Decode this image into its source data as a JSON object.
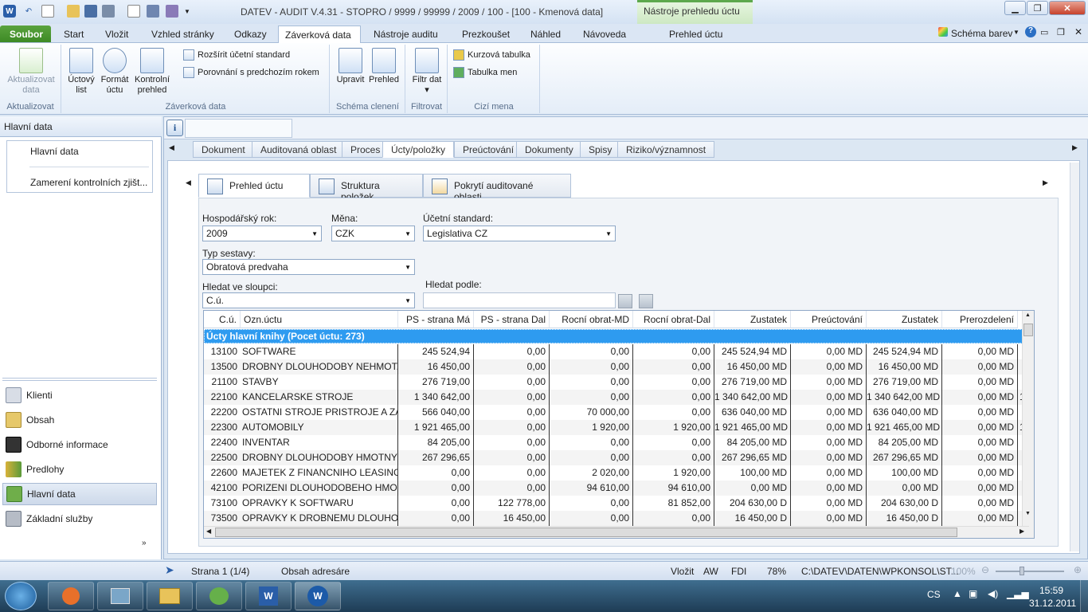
{
  "window": {
    "title": "DATEV - AUDIT V.4.31 - STOPRO / 9999 / 99999 / 2009 / 100  - [100 - Kmenová data]",
    "context_title": "Nástroje prehledu úctu"
  },
  "ribbon_tabs": [
    "Soubor",
    "Start",
    "Vložit",
    "Vzhled stránky",
    "Odkazy",
    "Záverková data",
    "Nástroje auditu",
    "Prezkoušet",
    "Náhled",
    "Návoveda",
    "Prehled úctu"
  ],
  "ribbon_right": {
    "scheme": "Schéma barev"
  },
  "ribbon": {
    "g1": {
      "btn": "Aktualizovat data",
      "label": "Aktualizovat"
    },
    "g2": {
      "b1": "Úctový list",
      "b2": "Formát úctu",
      "b3": "Kontrolní prehled",
      "s1": "Rozšírit účetní standard",
      "s2": "Porovnání s predchozím rokem",
      "label": "Záverková data"
    },
    "g3": {
      "b1": "Upravit",
      "b2": "Prehled",
      "label": "Schéma clenení"
    },
    "g4": {
      "b1": "Filtr dat",
      "label": "Filtrovat"
    },
    "g5": {
      "s1": "Kurzová tabulka",
      "s2": "Tabulka men",
      "label": "Cizí mena"
    }
  },
  "left": {
    "header": "Hlavní data",
    "items": [
      "Hlavní data",
      "Zamerení kontrolních zjišt..."
    ],
    "nav": [
      "Klienti",
      "Obsah",
      "Odborné informace",
      "Predlohy",
      "Hlavní data",
      "Základní služby"
    ]
  },
  "tabs2": [
    "Dokument",
    "Auditovaná oblast",
    "Proces",
    "Úcty/položky",
    "Preúctování",
    "Dokumenty",
    "Spisy",
    "Riziko/významnost"
  ],
  "tabs3": [
    "Prehled úctu",
    "Struktura položek",
    "Pokrytí auditované oblasti"
  ],
  "form": {
    "year_label": "Hospodářský rok:",
    "year": "2009",
    "cur_label": "Měna:",
    "cur": "CZK",
    "std_label": "Účetní standard:",
    "std": "Legislativa CZ",
    "type_label": "Typ sestavy:",
    "type": "Obratová predvaha",
    "search_col_label": "Hledat ve sloupci:",
    "search_col": "C.ú.",
    "search_by_label": "Hledat podle:",
    "search_by": ""
  },
  "grid": {
    "headers": [
      "C.ú.",
      "Ozn.úctu",
      "PS - strana Má ...",
      "PS - strana Dal",
      "Rocní obrat-MD",
      "Rocní obrat-Dal",
      "Zustatek",
      "Preúctování",
      "Zustatek",
      "Prerozdelení"
    ],
    "group": "Úcty hlavní knihy (Pocet úctu: 273)",
    "rows": [
      [
        "13100",
        "SOFTWARE",
        "245 524,94",
        "0,00",
        "0,00",
        "0,00",
        "245 524,94  MD",
        "0,00  MD",
        "245 524,94  MD",
        "0,00  MD",
        ""
      ],
      [
        "13500",
        "DROBNY DLOUHODOBY NEHMOT...",
        "16 450,00",
        "0,00",
        "0,00",
        "0,00",
        "16 450,00  MD",
        "0,00  MD",
        "16 450,00  MD",
        "0,00  MD",
        ""
      ],
      [
        "21100",
        "STAVBY",
        "276 719,00",
        "0,00",
        "0,00",
        "0,00",
        "276 719,00  MD",
        "0,00  MD",
        "276 719,00  MD",
        "0,00  MD",
        ""
      ],
      [
        "22100",
        "KANCELARSKE STROJE",
        "1 340 642,00",
        "0,00",
        "0,00",
        "0,00",
        "1 340 642,00  MD",
        "0,00  MD",
        "1 340 642,00  MD",
        "0,00  MD",
        "1"
      ],
      [
        "22200",
        "OSTATNI STROJE PRISTROJE A ZA...",
        "566 040,00",
        "0,00",
        "70 000,00",
        "0,00",
        "636 040,00  MD",
        "0,00  MD",
        "636 040,00  MD",
        "0,00  MD",
        ""
      ],
      [
        "22300",
        "AUTOMOBILY",
        "1 921 465,00",
        "0,00",
        "1 920,00",
        "1 920,00",
        "1 921 465,00  MD",
        "0,00  MD",
        "1 921 465,00  MD",
        "0,00  MD",
        "1"
      ],
      [
        "22400",
        "INVENTAR",
        "84 205,00",
        "0,00",
        "0,00",
        "0,00",
        "84 205,00  MD",
        "0,00  MD",
        "84 205,00  MD",
        "0,00  MD",
        ""
      ],
      [
        "22500",
        "DROBNY DLOUHODOBY HMOTNY ...",
        "267 296,65",
        "0,00",
        "0,00",
        "0,00",
        "267 296,65  MD",
        "0,00  MD",
        "267 296,65  MD",
        "0,00  MD",
        ""
      ],
      [
        "22600",
        "MAJETEK Z FINANCNIHO LEASINGU",
        "0,00",
        "0,00",
        "2 020,00",
        "1 920,00",
        "100,00  MD",
        "0,00  MD",
        "100,00  MD",
        "0,00  MD",
        ""
      ],
      [
        "42100",
        "PORIZENI DLOUHODOBEHO HMOT...",
        "0,00",
        "0,00",
        "94 610,00",
        "94 610,00",
        "0,00  MD",
        "0,00  MD",
        "0,00  MD",
        "0,00  MD",
        ""
      ],
      [
        "73100",
        "OPRAVKY K SOFTWARU",
        "0,00",
        "122 778,00",
        "0,00",
        "81 852,00",
        "204 630,00 D",
        "0,00  MD",
        "204 630,00 D",
        "0,00  MD",
        ""
      ],
      [
        "73500",
        "OPRAVKY K DROBNEMU DLOUHO...",
        "0,00",
        "16 450,00",
        "0,00",
        "0,00",
        "16 450,00 D",
        "0,00  MD",
        "16 450,00 D",
        "0,00  MD",
        ""
      ]
    ]
  },
  "status": {
    "page": "Strana 1 (1/4)",
    "section": "Obsah adresáre",
    "mode": "Vložit",
    "aw": "AW",
    "fdi": "FDI",
    "pct": "78%",
    "path": "C:\\DATEV\\DATEN\\WPKONSOL\\ST...",
    "zoom": "100%"
  },
  "taskbar": {
    "lang": "CS",
    "time": "15:59",
    "date": "31.12.2011"
  },
  "colors": {
    "accent": "#2e9bf0",
    "soubor": "#4a9a32"
  }
}
